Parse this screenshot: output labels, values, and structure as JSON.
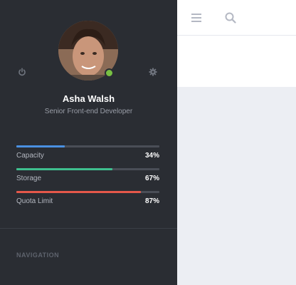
{
  "topbar": {
    "menu_icon": "hamburger-icon",
    "search_icon": "search-icon"
  },
  "profile": {
    "name": "Asha Walsh",
    "title": "Senior Front-end Developer",
    "status": "online",
    "power_icon": "power-icon",
    "settings_icon": "gear-icon"
  },
  "stats": [
    {
      "label": "Capacity",
      "value": "34%",
      "fraction": 0.34,
      "color": "#4a90e2"
    },
    {
      "label": "Storage",
      "value": "67%",
      "fraction": 0.67,
      "color": "#3fbf8f"
    },
    {
      "label": "Quota Limit",
      "value": "87%",
      "fraction": 0.87,
      "color": "#e5584a"
    }
  ],
  "navigation": {
    "heading": "NAVIGATION"
  }
}
